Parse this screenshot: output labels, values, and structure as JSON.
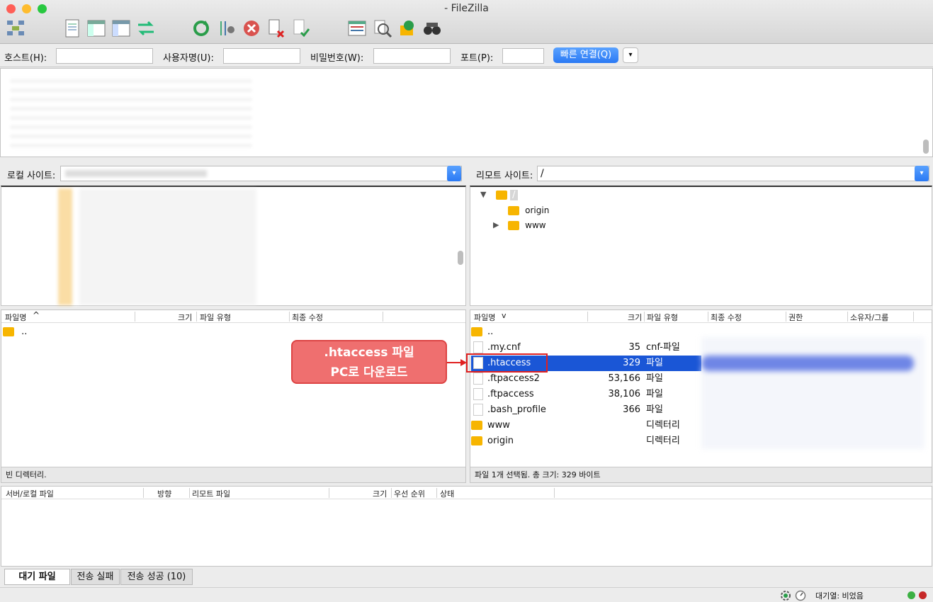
{
  "window": {
    "title": "- FileZilla"
  },
  "toolbar": {
    "icons": [
      "site-manager-icon",
      "message-log-icon",
      "local-tree-icon",
      "remote-tree-icon",
      "transfer-queue-icon",
      "refresh-icon",
      "process-queue-icon",
      "cancel-icon",
      "disconnect-icon",
      "reconnect-icon",
      "filter-icon",
      "compare-icon",
      "sync-browse-icon",
      "search-icon"
    ]
  },
  "quickconnect": {
    "host_label": "호스트(H):",
    "user_label": "사용자명(U):",
    "pass_label": "비밀번호(W):",
    "port_label": "포트(P):",
    "button": "빠른 연결(Q)",
    "dropdown": "▾"
  },
  "local": {
    "site_label": "로컬 사이트:",
    "columns": [
      "파일명",
      "크기",
      "파일 유형",
      "최종 수정"
    ],
    "sort_indicator": "^",
    "rows": [
      {
        "name": ".."
      }
    ],
    "status": "빈 디렉터리."
  },
  "remote": {
    "site_label": "리모트 사이트:",
    "path": "/",
    "tree": [
      {
        "name": "/"
      },
      {
        "name": "origin"
      },
      {
        "name": "www"
      }
    ],
    "columns": [
      "파일명",
      "크기",
      "파일 유형",
      "최종 수정",
      "권한",
      "소유자/그룹"
    ],
    "sort_indicator": "v",
    "rows": [
      {
        "name": "..",
        "size": "",
        "type": "",
        "kind": "folder"
      },
      {
        "name": ".my.cnf",
        "size": "35",
        "type": "cnf-파일",
        "kind": "file"
      },
      {
        "name": ".htaccess",
        "size": "329",
        "type": "파일",
        "kind": "file",
        "selected": true
      },
      {
        "name": ".ftpaccess2",
        "size": "53,166",
        "type": "파일",
        "kind": "file"
      },
      {
        "name": ".ftpaccess",
        "size": "38,106",
        "type": "파일",
        "kind": "file"
      },
      {
        "name": ".bash_profile",
        "size": "366",
        "type": "파일",
        "kind": "file"
      },
      {
        "name": "www",
        "size": "",
        "type": "디렉터리",
        "kind": "folder"
      },
      {
        "name": "origin",
        "size": "",
        "type": "디렉터리",
        "kind": "folder"
      }
    ],
    "status": "파일 1개 선택됨. 총 크기: 329 바이트"
  },
  "callout": {
    "line1": ".htaccess 파일",
    "line2": "PC로 다운로드"
  },
  "queue": {
    "columns": [
      "서버/로컬 파일",
      "방향",
      "리모트 파일",
      "크기",
      "우선 순위",
      "상태"
    ],
    "tabs": [
      "대기 파일",
      "전송 실패",
      "전송 성공 (10)"
    ]
  },
  "statusbar": {
    "queue_text": "대기열: 비었음"
  },
  "colors": {
    "accent": "#2a79f4",
    "selection": "#1a56d6",
    "folder": "#f7b500",
    "callout": "#ef6f6f",
    "highlight_box": "#e02020"
  }
}
